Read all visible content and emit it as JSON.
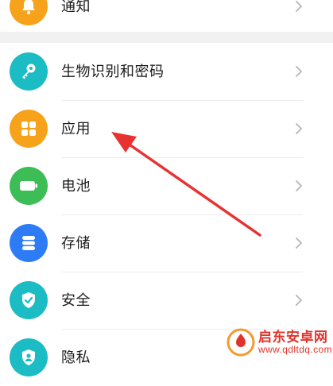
{
  "settings": {
    "items": [
      {
        "label": "通知",
        "color": "#f7a21b",
        "icon": "bell-icon"
      },
      {
        "label": "生物识别和密码",
        "color": "#1bbcc4",
        "icon": "key-icon"
      },
      {
        "label": "应用",
        "color": "#f7a21b",
        "icon": "apps-grid-icon"
      },
      {
        "label": "电池",
        "color": "#3cbd55",
        "icon": "battery-icon"
      },
      {
        "label": "存储",
        "color": "#2e7cf5",
        "icon": "storage-icon"
      },
      {
        "label": "安全",
        "color": "#1bbcc4",
        "icon": "shield-check-icon"
      },
      {
        "label": "隐私",
        "color": "#1bbcc4",
        "icon": "privacy-icon"
      }
    ]
  },
  "annotation": {
    "color": "#e83232",
    "target": "应用"
  },
  "watermark": {
    "title": "启东安卓网",
    "url": "www.qdltdq.com"
  }
}
